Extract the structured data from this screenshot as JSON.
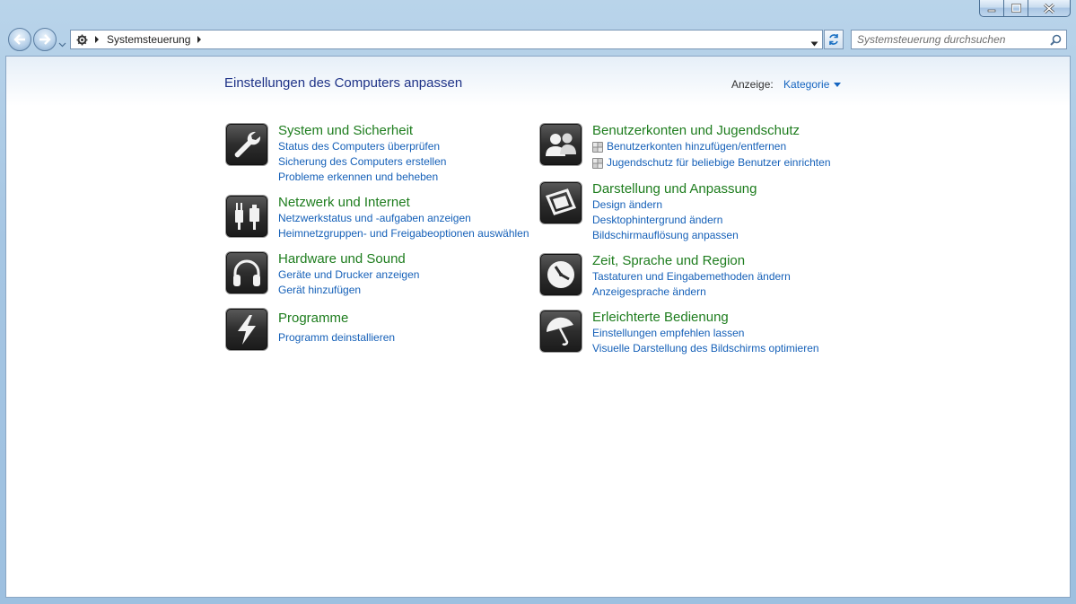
{
  "window": {
    "caption_buttons": [
      "minimize-icon",
      "maximize-icon",
      "close-icon"
    ]
  },
  "nav": {
    "breadcrumb": "Systemsteuerung",
    "search_placeholder": "Systemsteuerung durchsuchen"
  },
  "main": {
    "title": "Einstellungen des Computers anpassen",
    "view_label": "Anzeige:",
    "view_value": "Kategorie"
  },
  "categories": [
    {
      "title": "System und Sicherheit",
      "icon": "wrench-icon",
      "links": [
        "Status des Computers überprüfen",
        "Sicherung des Computers erstellen",
        "Probleme erkennen und beheben"
      ]
    },
    {
      "title": "Netzwerk und Internet",
      "icon": "network-plug-icon",
      "links": [
        "Netzwerkstatus und -aufgaben anzeigen",
        "Heimnetzgruppen- und Freigabeoptionen auswählen"
      ]
    },
    {
      "title": "Hardware und Sound",
      "icon": "headphones-icon",
      "links": [
        "Geräte und Drucker anzeigen",
        "Gerät hinzufügen"
      ]
    },
    {
      "title": "Programme",
      "icon": "lightning-icon",
      "links": [
        "Programm deinstallieren"
      ]
    },
    {
      "title": "Benutzerkonten und Jugendschutz",
      "icon": "users-icon",
      "links": [
        "Benutzerkonten hinzufügen/entfernen",
        "Jugendschutz für beliebige Benutzer einrichten"
      ]
    },
    {
      "title": "Darstellung und Anpassung",
      "icon": "display-frame-icon",
      "links": [
        "Design ändern",
        "Desktophintergrund ändern",
        "Bildschirmauflösung anpassen"
      ]
    },
    {
      "title": "Zeit, Sprache und Region",
      "icon": "clock-icon",
      "links": [
        "Tastaturen und Eingabemethoden ändern",
        "Anzeigesprache ändern"
      ]
    },
    {
      "title": "Erleichterte Bedienung",
      "icon": "umbrella-icon",
      "links": [
        "Einstellungen empfehlen lassen",
        "Visuelle Darstellung des Bildschirms optimieren"
      ]
    }
  ],
  "colors": {
    "category_title": "#1e7d1e",
    "link": "#1560b8",
    "page_title": "#1e3287"
  }
}
